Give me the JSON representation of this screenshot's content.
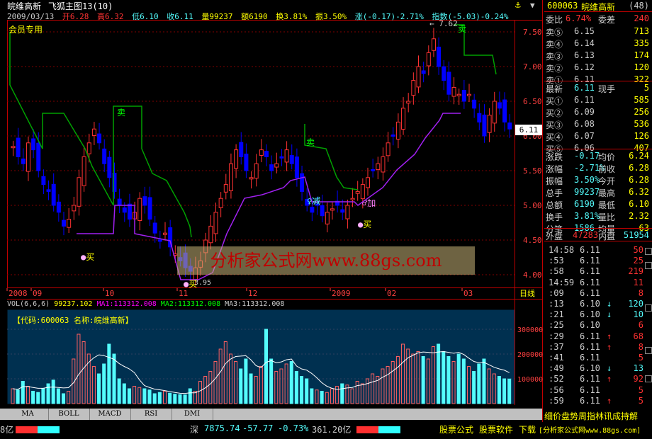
{
  "header": {
    "stock_name": "皖维高新",
    "formula_name": "飞狐主图13(10)",
    "member_label": "会员专用",
    "date": "2009/03/13",
    "open_label": "开6.28",
    "high_label": "高6.32",
    "low_label": "低6.10",
    "close_label": "收6.11",
    "vol_label": "量99237",
    "amount_label": "额6190",
    "turnover_label": "换3.81%",
    "amplitude_label": "振3.50%",
    "change_label": "涨(-0.17)-2.71%",
    "index_label": "指数(-5.03)-0.24%"
  },
  "price_axis": {
    "ticks": [
      "7.50",
      "7.00",
      "6.50",
      "6.00",
      "5.50",
      "5.00",
      "4.50",
      "4.00"
    ],
    "current": "6.11",
    "max_label": "7.62",
    "min_label": "3.95"
  },
  "time_axis": {
    "labels": [
      "2008",
      "09",
      "10",
      "11",
      "12",
      "2009",
      "02",
      "03"
    ],
    "period_label": "日线"
  },
  "signals": {
    "sell1": "卖",
    "sell2": "卖",
    "sell3": "卖",
    "buy1": "买",
    "buy2": "买",
    "buy3": "买",
    "reduce": "减",
    "add": "加"
  },
  "watermark": "分析家公式网www.88gs.com",
  "vol_header": {
    "name": "VOL(6,6,6)",
    "value": "99237.102",
    "ma1": "MA1:113312.008",
    "ma2": "MA2:113312.008",
    "ma3": "MA3:113312.008"
  },
  "vol_code": "【代码:600063 名称:皖维高新】",
  "vol_axis": [
    "300000",
    "200000",
    "100000"
  ],
  "tabs": [
    "MA",
    "BOLL",
    "MACD",
    "RSI",
    "DMI"
  ],
  "side": {
    "code": "600063",
    "name": "皖维高新",
    "num": "(48)",
    "weibi_label": "委比",
    "weibi": "6.74%",
    "weicha_label": "委差",
    "weicha": "240",
    "asks": [
      {
        "label": "卖⑤",
        "price": "6.15",
        "vol": "713"
      },
      {
        "label": "卖④",
        "price": "6.14",
        "vol": "335"
      },
      {
        "label": "卖③",
        "price": "6.13",
        "vol": "174"
      },
      {
        "label": "卖②",
        "price": "6.12",
        "vol": "120"
      },
      {
        "label": "卖①",
        "price": "6.11",
        "vol": "322"
      }
    ],
    "latest_label": "最新",
    "latest": "6.11",
    "xianshou_label": "现手",
    "xianshou": "5",
    "bids": [
      {
        "label": "买①",
        "price": "6.11",
        "vol": "585"
      },
      {
        "label": "买②",
        "price": "6.09",
        "vol": "256"
      },
      {
        "label": "买③",
        "price": "6.08",
        "vol": "536"
      },
      {
        "label": "买④",
        "price": "6.07",
        "vol": "126"
      },
      {
        "label": "买⑤",
        "price": "6.06",
        "vol": "407"
      }
    ],
    "stats": [
      {
        "l1": "涨跌",
        "v1": "-0.17",
        "l2": "均价",
        "v2": "6.24"
      },
      {
        "l1": "涨幅",
        "v1": "-2.71%",
        "l2": "前收",
        "v2": "6.28"
      },
      {
        "l1": "振幅",
        "v1": "3.50%",
        "l2": "今开",
        "v2": "6.28"
      },
      {
        "l1": "总手",
        "v1": "99237",
        "l2": "最高",
        "v2": "6.32"
      },
      {
        "l1": "总额",
        "v1": "6190",
        "l2": "最低",
        "v2": "6.10"
      },
      {
        "l1": "换手",
        "v1": "3.81%",
        "l2": "量比",
        "v2": "2.32"
      },
      {
        "l1": "分笔",
        "v1": "1586",
        "l2": "均量",
        "v2": "63"
      }
    ],
    "waipan_label": "外盘",
    "waipan": "47283",
    "neipan_label": "内盘",
    "neipan": "51954",
    "ticks": [
      {
        "t": "14:58",
        "p": "6.11",
        "a": "",
        "v": "50"
      },
      {
        "t": ":53",
        "p": "6.11",
        "a": "",
        "v": "25"
      },
      {
        "t": ":58",
        "p": "6.11",
        "a": "",
        "v": "219"
      },
      {
        "t": "14:59",
        "p": "6.11",
        "a": "",
        "v": "11"
      },
      {
        "t": ":09",
        "p": "6.11",
        "a": "",
        "v": "8"
      },
      {
        "t": ":13",
        "p": "6.10",
        "a": "↓",
        "v": "120"
      },
      {
        "t": ":21",
        "p": "6.10",
        "a": "↓",
        "v": "10"
      },
      {
        "t": ":25",
        "p": "6.10",
        "a": "",
        "v": "6"
      },
      {
        "t": ":29",
        "p": "6.11",
        "a": "↑",
        "v": "68"
      },
      {
        "t": ":37",
        "p": "6.11",
        "a": "↑",
        "v": "8"
      },
      {
        "t": ":41",
        "p": "6.11",
        "a": "",
        "v": "5"
      },
      {
        "t": ":49",
        "p": "6.10",
        "a": "↓",
        "v": "13"
      },
      {
        "t": ":52",
        "p": "6.11",
        "a": "↑",
        "v": "92"
      },
      {
        "t": ":56",
        "p": "6.11",
        "a": "",
        "v": "5"
      },
      {
        "t": ":59",
        "p": "6.11",
        "a": "↑",
        "v": "5"
      }
    ],
    "bottom_links": "细价盘势周指林讯成持解"
  },
  "status": {
    "left_frag": "8亿",
    "market": "深",
    "index": "7875.74",
    "change": "-57.77",
    "pct": "-0.73%",
    "amount": "361.20亿",
    "ad1": "股票公式",
    "ad2": "股票软件",
    "ad3": "下载",
    "ad4": "[分析家公式网www.88gs.com]"
  },
  "colors": {
    "up": "#ff3232",
    "down": "#0000ff",
    "cyan": "#54fcfc",
    "yellow": "#ffff00",
    "green": "#00ff00",
    "purple": "#a020f0",
    "volbg": "#003050"
  }
}
